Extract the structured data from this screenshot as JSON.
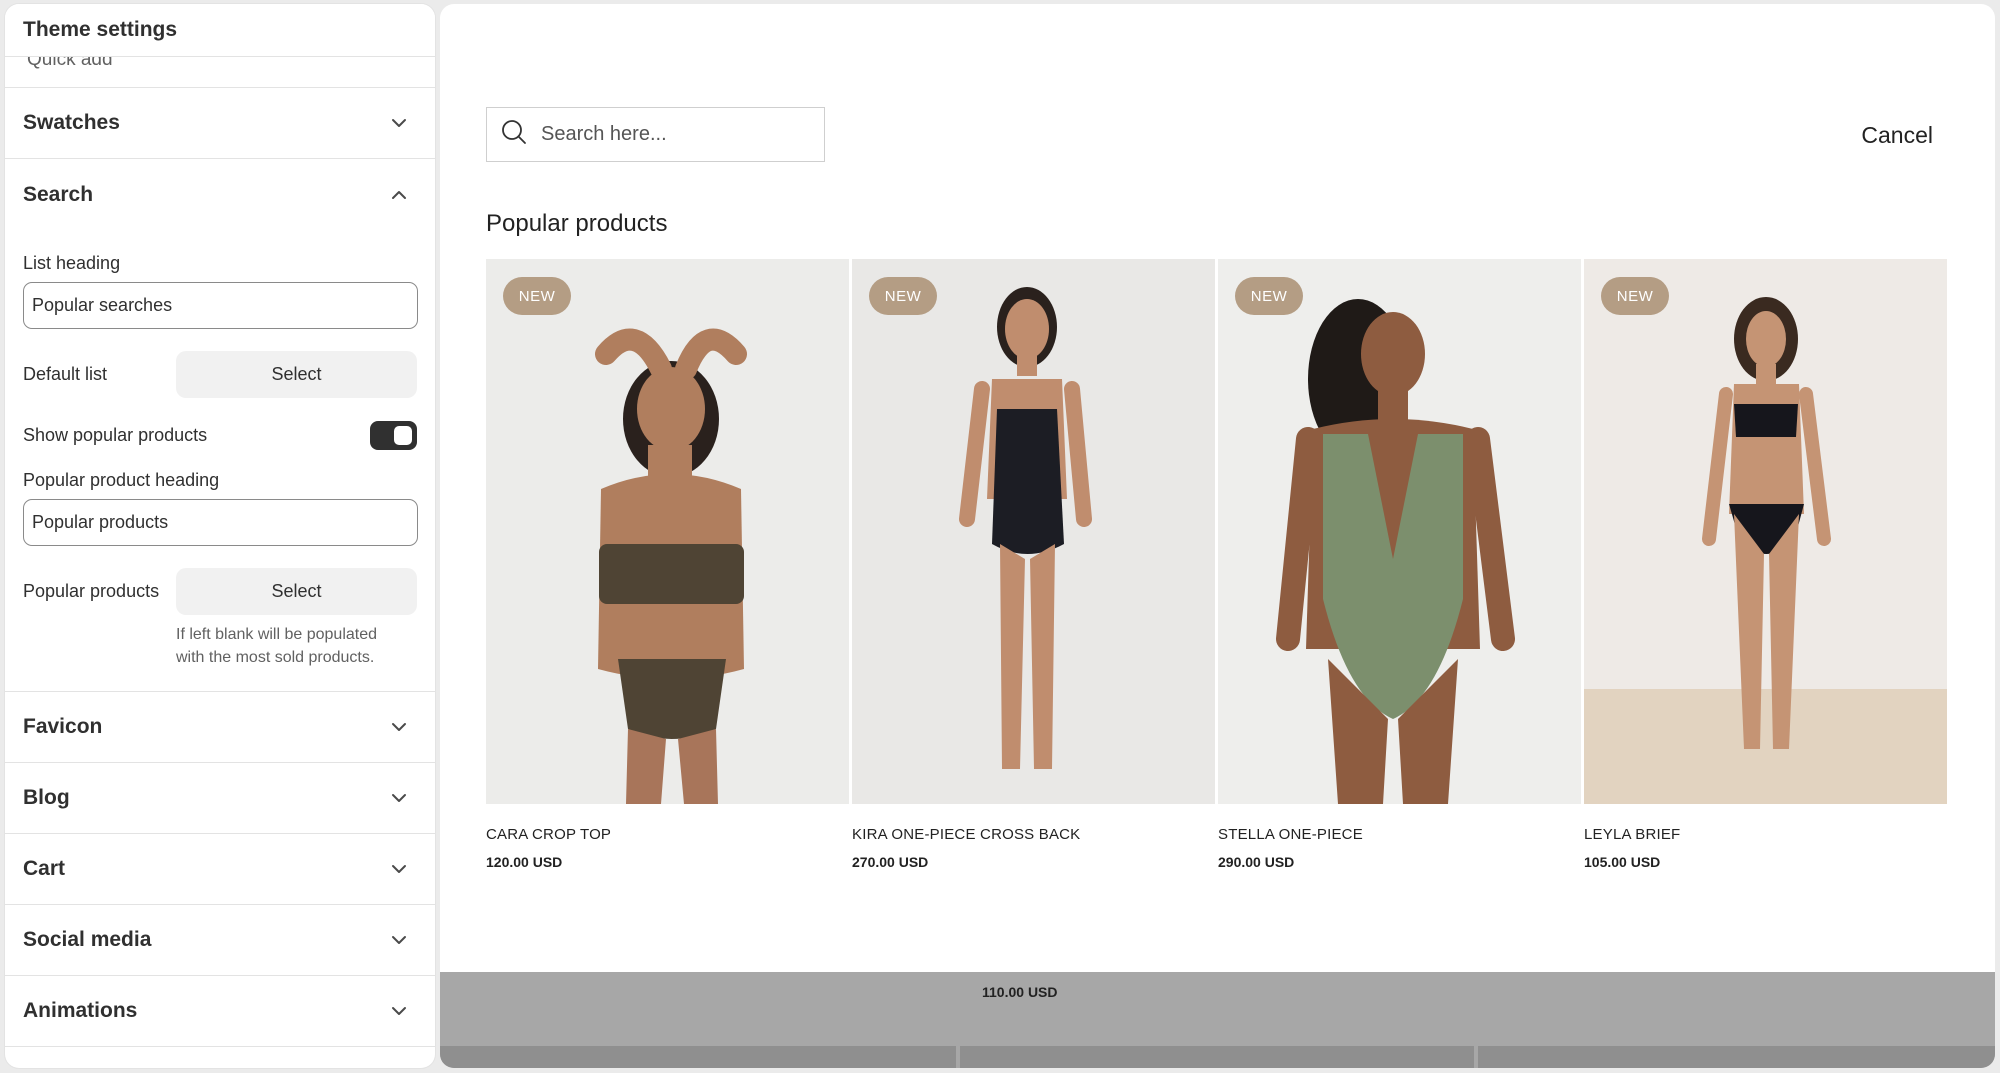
{
  "sidebar": {
    "title": "Theme settings",
    "peek_label": "Quick add",
    "sections_above": [
      {
        "label": "Swatches"
      }
    ],
    "search": {
      "label": "Search",
      "list_heading_label": "List heading",
      "list_heading_value": "Popular searches",
      "default_list_label": "Default list",
      "select_label": "Select",
      "show_popular_label": "Show popular products",
      "show_popular_on": true,
      "popular_heading_label": "Popular product heading",
      "popular_heading_value": "Popular products",
      "popular_products_label": "Popular products",
      "help_line1": "If left blank will be populated",
      "help_line2": "with the most sold products."
    },
    "sections_below": [
      {
        "label": "Favicon"
      },
      {
        "label": "Blog"
      },
      {
        "label": "Cart"
      },
      {
        "label": "Social media"
      },
      {
        "label": "Animations"
      }
    ]
  },
  "preview": {
    "search_placeholder": "Search here...",
    "cancel_label": "Cancel",
    "popular_title": "Popular products",
    "badge": "NEW",
    "products": [
      {
        "name": "CARA CROP TOP",
        "price": "120.00 USD",
        "suit_color": "#4f4434"
      },
      {
        "name": "KIRA ONE-PIECE CROSS BACK",
        "price": "270.00 USD",
        "suit_color": "#1c1d24"
      },
      {
        "name": "STELLA ONE-PIECE",
        "price": "290.00 USD",
        "suit_color": "#7c8f6d"
      },
      {
        "name": "LEYLA BRIEF",
        "price": "105.00 USD",
        "suit_color": "#16161c"
      }
    ],
    "overlay_price": "110.00 USD"
  },
  "colors": {
    "toggle_on": "#303030",
    "badge": "#b49d84",
    "overlay": "#a7a7a7"
  }
}
